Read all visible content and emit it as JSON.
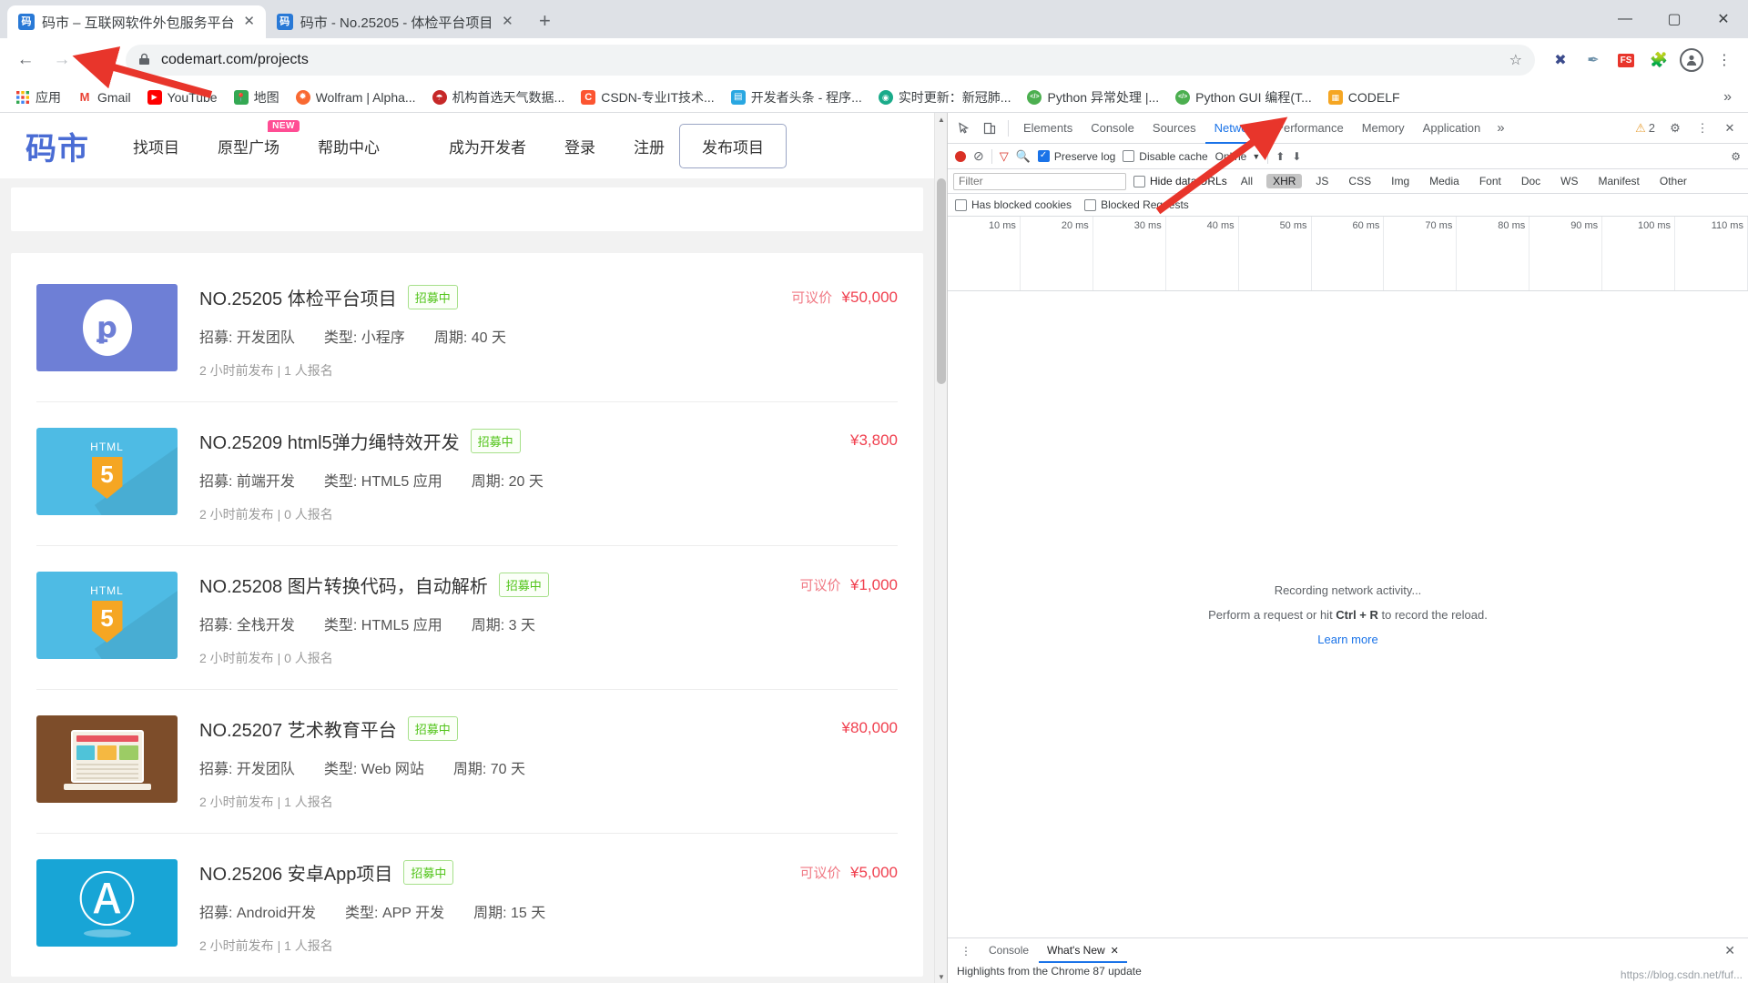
{
  "browser": {
    "tabs": [
      {
        "favicon": "码",
        "title": "码市 – 互联网软件外包服务平台",
        "active": true,
        "close": "✕"
      },
      {
        "favicon": "码",
        "title": "码市 - No.25205 - 体检平台项目",
        "active": false,
        "close": "✕"
      }
    ],
    "newtab_label": "+",
    "window_controls": {
      "minimize": "—",
      "maximize": "▢",
      "close": "✕"
    },
    "toolbar": {
      "back": "←",
      "forward": "→",
      "reload": "⟳",
      "lock": "🔒",
      "url": "codemart.com/projects",
      "star": "☆",
      "ext1": "✖",
      "ext2": "✒",
      "ext3": "FS",
      "ext4": "🧩",
      "profile": "👤",
      "menu": "⋮"
    },
    "bookmarks": [
      {
        "label": "应用",
        "icon": "apps",
        "color": "#ffffff"
      },
      {
        "label": "Gmail",
        "icon": "M",
        "color": "#ea4335"
      },
      {
        "label": "YouTube",
        "icon": "▶",
        "color": "#ff0000"
      },
      {
        "label": "地图",
        "icon": "📍",
        "color": "#34a853"
      },
      {
        "label": "Wolfram | Alpha...",
        "icon": "✹",
        "color": "#f96932"
      },
      {
        "label": "机构首选天气数据...",
        "icon": "☂",
        "color": "#c62828"
      },
      {
        "label": "CSDN-专业IT技术...",
        "icon": "C",
        "color": "#fc5531"
      },
      {
        "label": "开发者头条 - 程序...",
        "icon": "▤",
        "color": "#29a7e1"
      },
      {
        "label": "实时更新：新冠肺...",
        "icon": "◉",
        "color": "#1aab8a"
      },
      {
        "label": "Python 异常处理 |...",
        "icon": "</>",
        "color": "#4caf50"
      },
      {
        "label": "Python GUI 编程(T...",
        "icon": "</>",
        "color": "#4caf50"
      },
      {
        "label": "CODELF",
        "icon": "▦",
        "color": "#f5a623"
      }
    ],
    "bookmarks_overflow": "»"
  },
  "site": {
    "logo": "码市",
    "nav": [
      {
        "label": "找项目",
        "badge": ""
      },
      {
        "label": "原型广场",
        "badge": "NEW"
      },
      {
        "label": "帮助中心",
        "badge": ""
      },
      {
        "label": "成为开发者",
        "badge": ""
      },
      {
        "label": "登录",
        "badge": ""
      },
      {
        "label": "注册",
        "badge": ""
      }
    ],
    "publish_button": "发布项目",
    "labels": {
      "recruit": "招募:",
      "type": "类型:",
      "period": "周期:",
      "negotiable": "可议价"
    },
    "projects": [
      {
        "no": "NO.25205",
        "name": "体检平台项目",
        "status_tag": "招募中",
        "recruit": "招募: 开发团队",
        "type": "类型: 小程序",
        "period": "周期: 40 天",
        "posted": "2 小时前发布  |  1 人报名",
        "price_prefix": "可议价",
        "price": "¥50,000",
        "thumb": "wechat-miniprogram"
      },
      {
        "no": "NO.25209",
        "name": "html5弹力绳特效开发",
        "status_tag": "招募中",
        "recruit": "招募: 前端开发",
        "type": "类型: HTML5 应用",
        "period": "周期: 20 天",
        "posted": "2 小时前发布  |  0 人报名",
        "price_prefix": "",
        "price": "¥3,800",
        "thumb": "html5"
      },
      {
        "no": "NO.25208",
        "name": "图片转换代码，自动解析",
        "status_tag": "招募中",
        "recruit": "招募: 全栈开发",
        "type": "类型: HTML5 应用",
        "period": "周期: 3 天",
        "posted": "2 小时前发布  |  0 人报名",
        "price_prefix": "可议价",
        "price": "¥1,000",
        "thumb": "html5"
      },
      {
        "no": "NO.25207",
        "name": "艺术教育平台",
        "status_tag": "招募中",
        "recruit": "招募: 开发团队",
        "type": "类型: Web 网站",
        "period": "周期: 70 天",
        "posted": "2 小时前发布  |  1 人报名",
        "price_prefix": "",
        "price": "¥80,000",
        "thumb": "education"
      },
      {
        "no": "NO.25206",
        "name": "安卓App项目",
        "status_tag": "招募中",
        "recruit": "招募: Android开发",
        "type": "类型: APP 开发",
        "period": "周期: 15 天",
        "posted": "2 小时前发布  |  1 人报名",
        "price_prefix": "可议价",
        "price": "¥5,000",
        "thumb": "appstore"
      }
    ]
  },
  "devtools": {
    "inspect_icon": "⌖",
    "device_icon": "▯",
    "tabs": [
      {
        "label": "Elements",
        "active": false
      },
      {
        "label": "Console",
        "active": false
      },
      {
        "label": "Sources",
        "active": false
      },
      {
        "label": "Network",
        "active": true
      },
      {
        "label": "Performance",
        "active": false
      },
      {
        "label": "Memory",
        "active": false
      },
      {
        "label": "Application",
        "active": false
      }
    ],
    "more": "»",
    "warning_count": "2",
    "warning_icon": "⚠",
    "settings_icon": "⚙",
    "kebab_icon": "⋮",
    "close_icon": "✕",
    "network_toolbar": {
      "record": "record-button",
      "clear": "⊘",
      "filter_funnel": "▽",
      "search": "🔍",
      "preserve_log": {
        "label": "Preserve log",
        "checked": true
      },
      "disable_cache": {
        "label": "Disable cache",
        "checked": false
      },
      "throttle": "Online",
      "throttle_caret": "▼",
      "import_icon": "⬆",
      "export_icon": "⬇",
      "gear_icon": "⚙"
    },
    "filter_bar": {
      "filter_placeholder": "Filter",
      "filter_value": "",
      "hide_data_urls": {
        "label": "Hide data URLs",
        "checked": false
      },
      "types": [
        {
          "label": "All",
          "selected": false
        },
        {
          "label": "XHR",
          "selected": true
        },
        {
          "label": "JS",
          "selected": false
        },
        {
          "label": "CSS",
          "selected": false
        },
        {
          "label": "Img",
          "selected": false
        },
        {
          "label": "Media",
          "selected": false
        },
        {
          "label": "Font",
          "selected": false
        },
        {
          "label": "Doc",
          "selected": false
        },
        {
          "label": "WS",
          "selected": false
        },
        {
          "label": "Manifest",
          "selected": false
        },
        {
          "label": "Other",
          "selected": false
        }
      ],
      "has_blocked_cookies": {
        "label": "Has blocked cookies",
        "checked": false
      },
      "blocked_requests": {
        "label": "Blocked Requests",
        "checked": false
      }
    },
    "timeline_ticks": [
      "10 ms",
      "20 ms",
      "30 ms",
      "40 ms",
      "50 ms",
      "60 ms",
      "70 ms",
      "80 ms",
      "90 ms",
      "100 ms",
      "110 ms"
    ],
    "empty_state": {
      "line1": "Recording network activity...",
      "line2_prefix": "Perform a request or hit ",
      "line2_shortcut": "Ctrl + R",
      "line2_suffix": " to record the reload.",
      "learn_more": "Learn more"
    },
    "drawer": {
      "kebab": "⋮",
      "tabs": [
        {
          "label": "Console",
          "active": false,
          "closable": false
        },
        {
          "label": "What's New",
          "active": true,
          "closable": true,
          "close": "✕"
        }
      ],
      "close": "✕",
      "body_text": "Highlights from the Chrome 87 update"
    }
  },
  "status_url": "https://blog.csdn.net/fuf...",
  "page_scrollbar": {
    "up": "▲",
    "down": "▼"
  },
  "colors": {
    "brand": "#4a6cd4",
    "price": "#f0404f",
    "tag_green": "#52c41a",
    "devtools_active": "#1a73e8",
    "badge_pink": "#ff4d94",
    "annotation_red": "#e8352b"
  }
}
